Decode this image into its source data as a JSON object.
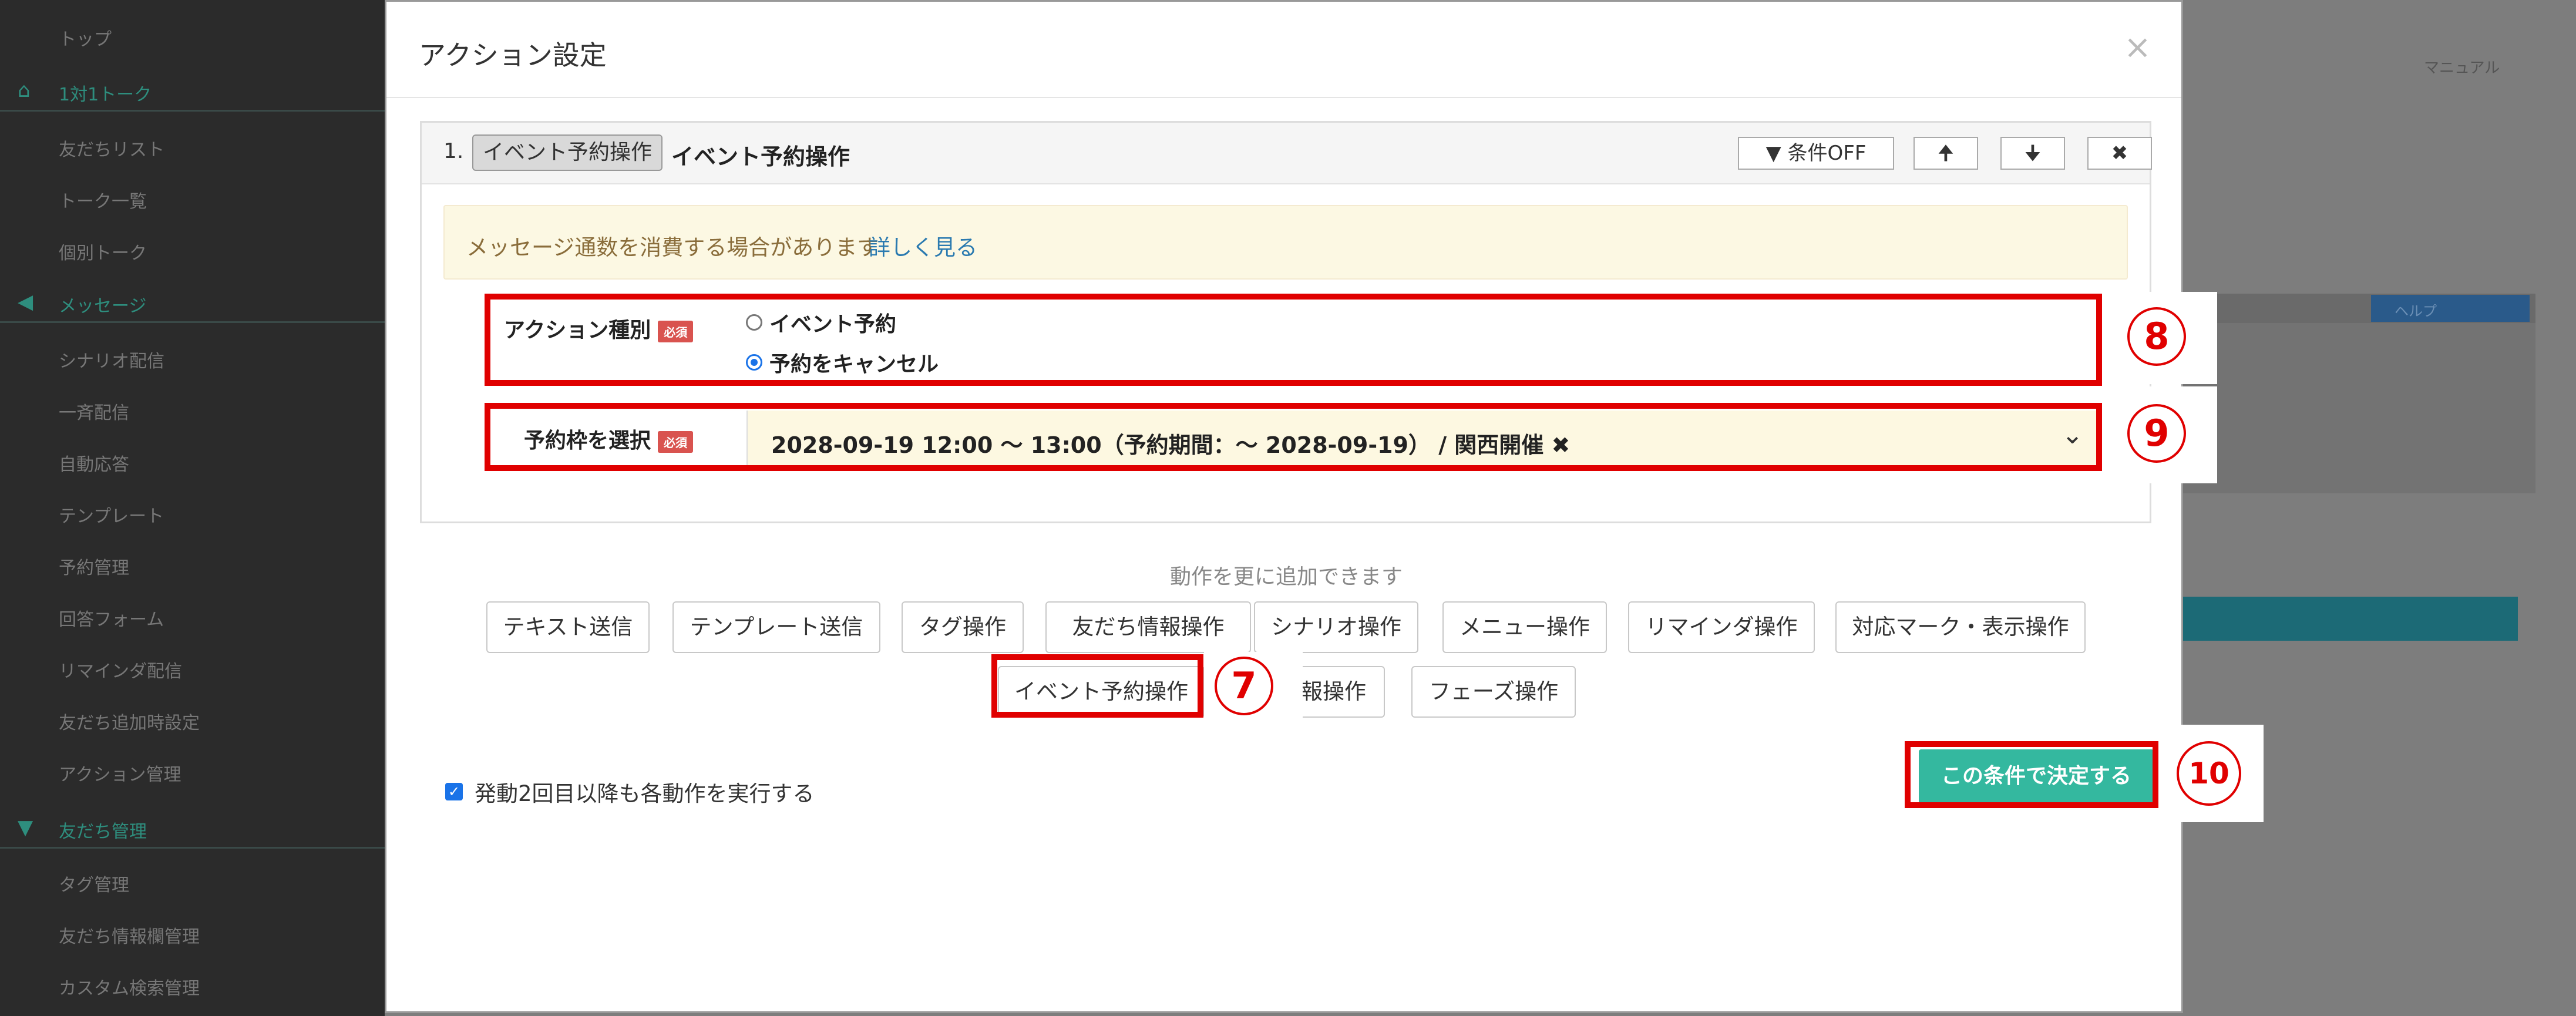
{
  "sidebar": {
    "items": [
      "トップ",
      "友だちリスト",
      "トーク一覧",
      "個別トーク",
      "シナリオ配信",
      "一斉配信",
      "自動応答",
      "テンプレート",
      "予約管理",
      "回答フォーム",
      "リマインダ配信",
      "友だち追加時設定",
      "アクション管理",
      "タグ管理",
      "友だち情報欄管理",
      "カスタム検索管理"
    ],
    "sections": [
      "1対1トーク",
      "メッセージ",
      "友だち管理"
    ]
  },
  "background": {
    "manual_label": "マニュアル",
    "help_label": "ヘルプ"
  },
  "modal": {
    "title": "アクション設定",
    "close_glyph": "×",
    "card": {
      "number": "1.",
      "type_tag": "イベント予約操作",
      "title": "イベント予約操作",
      "filter_button": "条件OFF",
      "up_glyph": "🠉",
      "down_glyph": "🠋",
      "delete_glyph": "✖",
      "alert_text": "メッセージ通数を消費する場合があります",
      "alert_link": "詳しく見る",
      "action_type_label": "アクション種別",
      "required_badge": "必須",
      "radio_options": [
        "イベント予約",
        "予約をキャンセル"
      ],
      "slot_label": "予約枠を選択",
      "slot_value": "2028-09-19 12:00 ～ 13:00（予約期間：～ 2028-09-19） / 関西開催 ✖",
      "chevron": "⌄"
    },
    "add_caption": "動作を更に追加できます",
    "operation_buttons_row1": [
      "テキスト送信",
      "テンプレート送信",
      "タグ操作",
      "友だち情報操作",
      "シナリオ操作",
      "メニュー操作",
      "リマインダ操作",
      "対応マーク・表示操作"
    ],
    "operation_buttons_row2": [
      "イベント予約操作",
      "情報操作",
      "フェーズ操作"
    ],
    "checkbox_label": "発動2回目以降も各動作を実行する",
    "submit_label": "この条件で決定する"
  },
  "annotations": {
    "seven": "7",
    "eight": "8",
    "nine": "9",
    "ten": "10"
  }
}
